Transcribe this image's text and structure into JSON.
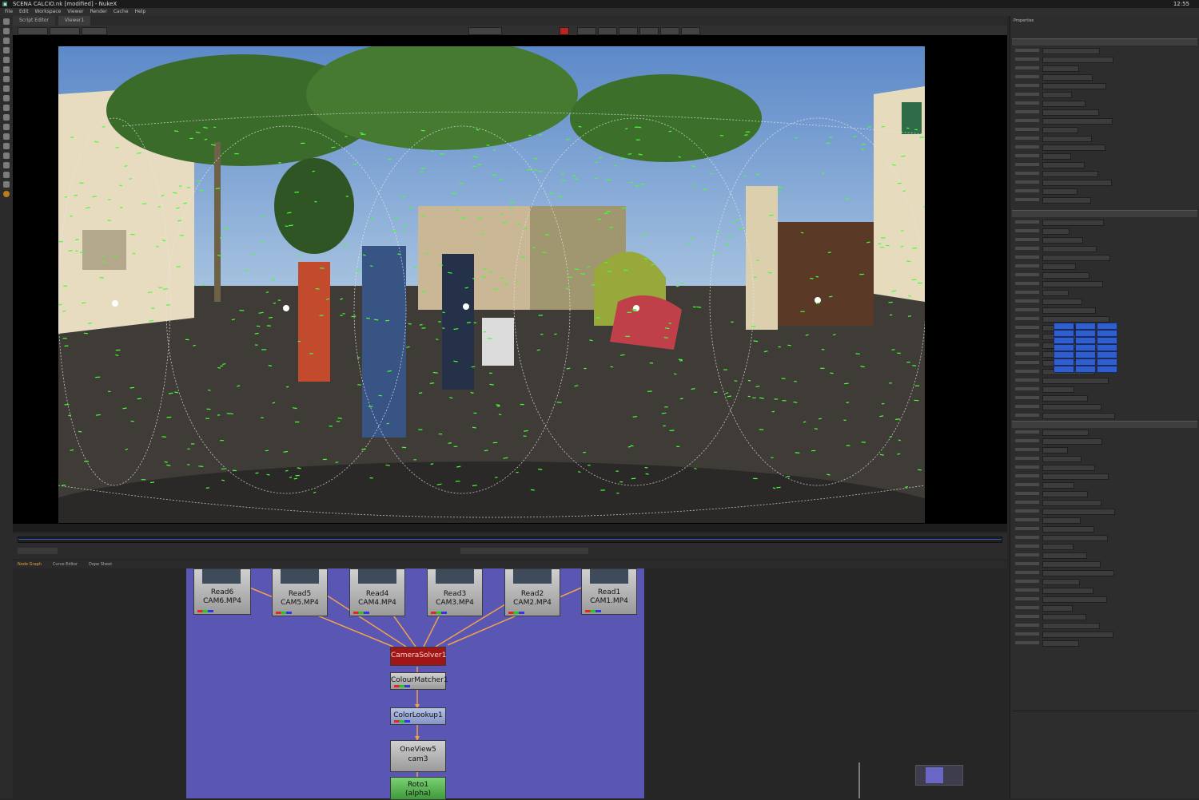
{
  "titlebar": {
    "title": "SCENA CALCIO.nk [modified] - NukeX",
    "clock": "12:55"
  },
  "menu": [
    "File",
    "Edit",
    "Workspace",
    "Viewer",
    "Render",
    "Cache",
    "Help"
  ],
  "viewer": {
    "tabs": [
      "Script Editor",
      "Viewer1"
    ]
  },
  "dag": {
    "tabs": [
      "Node Graph",
      "Curve Editor",
      "Dope Sheet"
    ],
    "nodes": {
      "read6": {
        "name": "Read6",
        "file": "CAM6.MP4"
      },
      "read5": {
        "name": "Read5",
        "file": "CAM5.MP4"
      },
      "read4": {
        "name": "Read4",
        "file": "CAM4.MP4"
      },
      "read3": {
        "name": "Read3",
        "file": "CAM3.MP4"
      },
      "read2": {
        "name": "Read2",
        "file": "CAM2.MP4"
      },
      "read1": {
        "name": "Read1",
        "file": "CAM1.MP4"
      },
      "camerasolver": "CameraSolver1",
      "colourmatcher": "ColourMatcher1",
      "colorlookup": "ColorLookup1",
      "onoview": {
        "name": "OneView5",
        "sub": "cam3"
      },
      "roto": {
        "name": "Roto1",
        "sub": "(alpha)"
      }
    }
  },
  "properties": {
    "title": "Properties"
  },
  "colors": {
    "backdrop": "#5a56b4",
    "camerasolver": "#a01616",
    "roto": "#55b34f",
    "edge": "#f0a24a",
    "tracker_points": "#44ff33"
  }
}
